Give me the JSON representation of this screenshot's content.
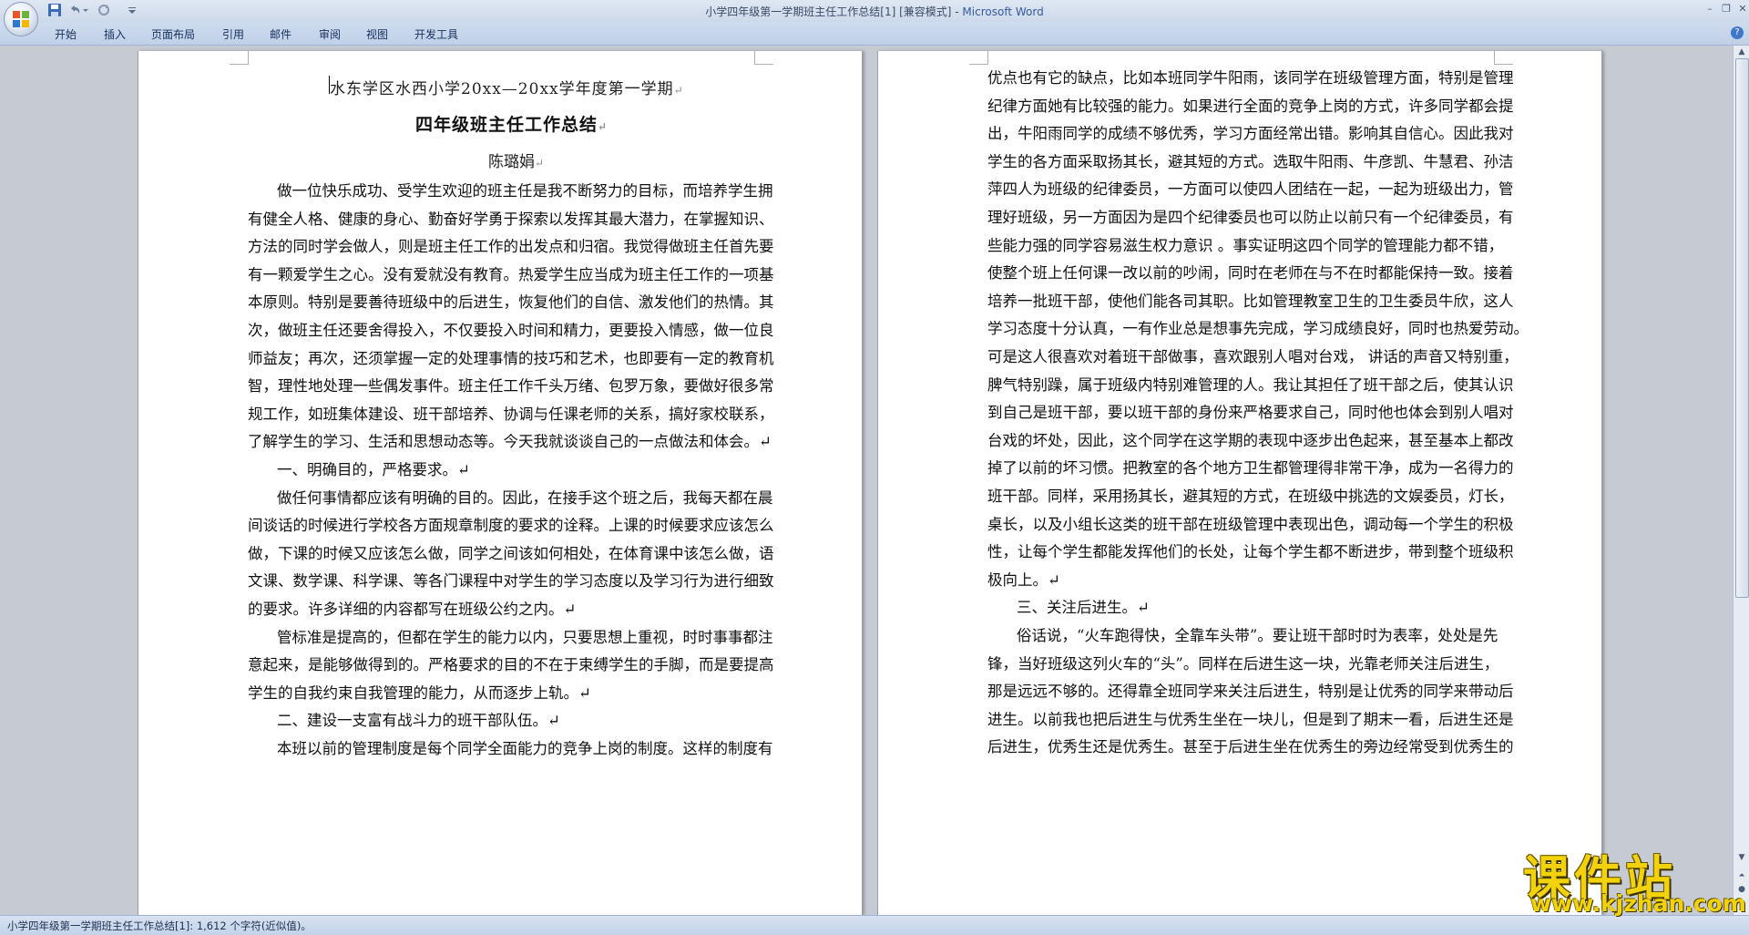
{
  "window": {
    "title": "小学四年级第一学期班主任工作总结[1] [兼容模式] - ",
    "app_name": "Microsoft Word"
  },
  "ribbon_tabs": [
    "开始",
    "插入",
    "页面布局",
    "引用",
    "邮件",
    "审阅",
    "视图",
    "开发工具"
  ],
  "document": {
    "header_school": "水东学区水西小学20xx—20xx学年度第一学期",
    "header_title": "四年级班主任工作总结",
    "author": "陈璐娟",
    "paragraph_mark": "↵",
    "page1_lines": [
      "做一位快乐成功、受学生欢迎的班主任是我不断努力的目标，而培养学生拥",
      "有健全人格、健康的身心、勤奋好学勇于探索以发挥其最大潜力，在掌握知识、",
      "方法的同时学会做人，则是班主任工作的出发点和归宿。我觉得做班主任首先要",
      "有一颗爱学生之心。没有爱就没有教育。热爱学生应当成为班主任工作的一项基",
      "本原则。特别是要善待班级中的后进生，恢复他们的自信、激发他们的热情。其",
      "次，做班主任还要舍得投入，不仅要投入时间和精力，更要投入情感，做一位良",
      "师益友；再次，还须掌握一定的处理事情的技巧和艺术，也即要有一定的教育机",
      "智，理性地处理一些偶发事件。班主任工作千头万绪、包罗万象，要做好很多常",
      "规工作，如班集体建设、班干部培养、协调与任课老师的关系，搞好家校联系，",
      "了解学生的学习、生活和思想动态等。今天我就谈谈自己的一点做法和体会。↵",
      "一、明确目的，严格要求。↵",
      "做任何事情都应该有明确的目的。因此，在接手这个班之后，我每天都在晨",
      "间谈话的时候进行学校各方面规章制度的要求的诠释。上课的时候要求应该怎么",
      "做，下课的时候又应该怎么做，同学之间该如何相处，在体育课中该怎么做，语",
      "文课、数学课、科学课、等各门课程中对学生的学习态度以及学习行为进行细致",
      "的要求。许多详细的内容都写在班级公约之内。↵",
      "管标准是提高的，但都在学生的能力以内，只要思想上重视，时时事事都注",
      "意起来，是能够做得到的。严格要求的目的不在于束缚学生的手脚，而是要提高",
      "学生的自我约束自我管理的能力，从而逐步上轨。↵",
      "二、建设一支富有战斗力的班干部队伍。↵",
      "本班以前的管理制度是每个同学全面能力的竞争上岗的制度。这样的制度有"
    ],
    "page2_lines": [
      "优点也有它的缺点，比如本班同学牛阳雨，该同学在班级管理方面，特别是管理",
      "纪律方面她有比较强的能力。如果进行全面的竞争上岗的方式，许多同学都会提",
      "出，牛阳雨同学的成绩不够优秀，学习方面经常出错。影响其自信心。因此我对",
      "学生的各方面采取扬其长，避其短的方式。选取牛阳雨、牛彦凯、牛慧君、孙洁",
      "萍四人为班级的纪律委员，一方面可以使四人团结在一起，一起为班级出力，管",
      "理好班级，另一方面因为是四个纪律委员也可以防止以前只有一个纪律委员，有",
      "些能力强的同学容易滋生权力意识 。事实证明这四个同学的管理能力都不错，",
      "使整个班上任何课一改以前的吵闹，同时在老师在与不在时都能保持一致。接着",
      "培养一批班干部，使他们能各司其职。比如管理教室卫生的卫生委员牛欣，这人",
      "学习态度十分认真，一有作业总是想事先完成，学习成绩良好，同时也热爱劳动。",
      "可是这人很喜欢对着班干部做事，喜欢跟别人唱对台戏， 讲话的声音又特别重，",
      "脾气特别躁，属于班级内特别难管理的人。我让其担任了班干部之后，使其认识",
      "到自己是班干部，要以班干部的身份来严格要求自己，同时他也体会到别人唱对",
      "台戏的坏处，因此，这个同学在这学期的表现中逐步出色起来，甚至基本上都改",
      "掉了以前的坏习惯。把教室的各个地方卫生都管理得非常干净，成为一名得力的",
      "班干部。同样，采用扬其长，避其短的方式，在班级中挑选的文娱委员，灯长，",
      "桌长，以及小组长这类的班干部在班级管理中表现出色，调动每一个学生的积极",
      "性，让每个学生都能发挥他们的长处，让每个学生都不断进步，带到整个班级积",
      "极向上。↵",
      "三、关注后进生。↵",
      "俗话说，“火车跑得快，全靠车头带”。要让班干部时时为表率，处处是先",
      "锋，当好班级这列火车的“头”。同样在后进生这一块，光靠老师关注后进生，",
      "那是远远不够的。还得靠全班同学来关注后进生，特别是让优秀的同学来带动后",
      "进生。以前我也把后进生与优秀生坐在一块儿，但是到了期末一看，后进生还是",
      "后进生，优秀生还是优秀生。甚至于后进生坐在优秀生的旁边经常受到优秀生的"
    ]
  },
  "status_bar": {
    "text": "小学四年级第一学期班主任工作总结[1]: 1,612 个字符(近似值)。"
  },
  "watermark": {
    "title": "课件站",
    "url": "www.kjzhan.com"
  }
}
